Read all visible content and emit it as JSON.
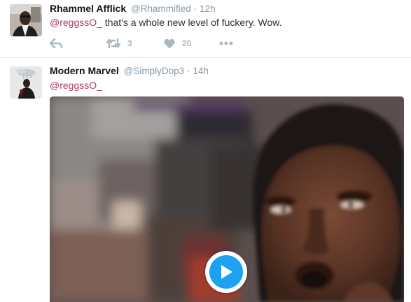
{
  "tweets": [
    {
      "name": "Rhammel Afflick",
      "handle": "@Rhammified",
      "separator": "·",
      "time": "12h",
      "mention": "@reggssO_",
      "text": " that's a whole new level of fuckery. Wow.",
      "retweet_count": "3",
      "like_count": "20",
      "avatar_icon": "person-avatar"
    },
    {
      "name": "Modern Marvel",
      "handle": "@SimplyDop3",
      "separator": "·",
      "time": "14h",
      "mention": "@reggssO_",
      "text": "",
      "avatar_icon": "person-avatar",
      "media": {
        "type": "video",
        "icon": "play-icon"
      }
    }
  ],
  "colors": {
    "accent": "#1da1f2",
    "mention": "#b0386a",
    "secondary_text": "#8899a6",
    "action_icons": "#aab8c2"
  }
}
